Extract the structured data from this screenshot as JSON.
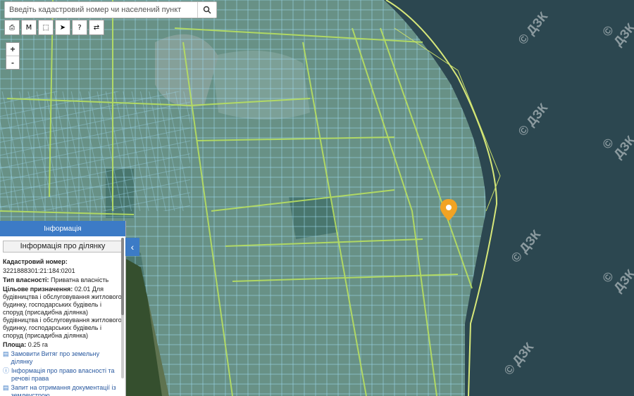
{
  "search": {
    "placeholder": "Введіть кадастровий номер чи населений пункт"
  },
  "toolbar": {
    "tools": [
      "print-icon",
      "measure-icon",
      "area-icon",
      "pointer-icon",
      "info-icon",
      "layers-icon"
    ],
    "measure_label": "M"
  },
  "zoom": {
    "in": "+",
    "out": "-"
  },
  "info_panel": {
    "header": "Інформація",
    "title": "Інформація про ділянку",
    "cadastral_label": "Кадастровий номер:",
    "cadastral_value": "3221888301:21:184:0201",
    "ownership_label": "Тип власності:",
    "ownership_value": "Приватна власність",
    "purpose_label": "Цільове призначення:",
    "purpose_value": "02.01 Для будівництва і обслуговування житлового будинку, господарських будівель і споруд (присадибна ділянка) будівництва і обслуговування житлового будинку, господарських будівель і споруд (присадибна ділянка)",
    "area_label": "Площа:",
    "area_value": "0.25 га",
    "links": [
      "Замовити Витяг про земельну ділянку",
      "Інформація про право власності та речові права",
      "Запит на отримання документації із землеустрою"
    ]
  },
  "watermark": "© ДЗК",
  "colors": {
    "accent": "#3c7bc6",
    "parcel": "#8fd3f0",
    "road": "#b8e060",
    "marker": "#f2a323",
    "water": "#2c4750"
  }
}
